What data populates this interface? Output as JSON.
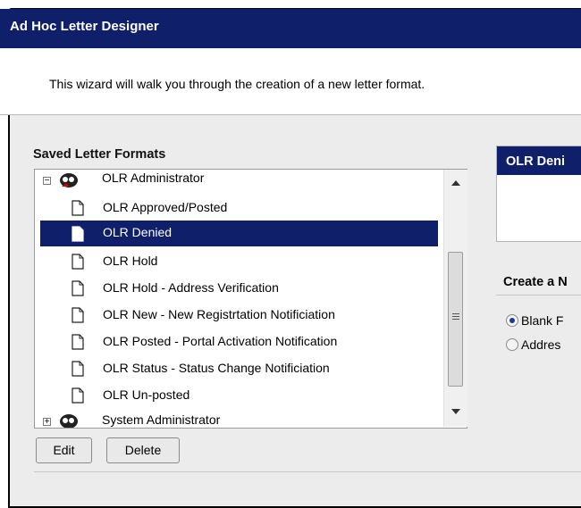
{
  "window": {
    "title": "Ad Hoc Letter Designer"
  },
  "intro": {
    "text": "This wizard will walk you through the creation of a new letter format."
  },
  "saved_formats": {
    "label": "Saved Letter Formats",
    "groups": [
      {
        "label": "OLR Administrator",
        "expanded": true
      },
      {
        "label": "System Administrator",
        "expanded": false
      }
    ],
    "items": [
      {
        "label": "OLR Approved/Posted",
        "selected": false
      },
      {
        "label": "OLR Denied",
        "selected": true
      },
      {
        "label": "OLR Hold",
        "selected": false
      },
      {
        "label": "OLR Hold - Address Verification",
        "selected": false
      },
      {
        "label": "OLR New - New Registrtation Notificiation",
        "selected": false
      },
      {
        "label": "OLR Posted - Portal Activation Notification",
        "selected": false
      },
      {
        "label": "OLR Status - Status Change Notificiation",
        "selected": false
      },
      {
        "label": "OLR Un-posted",
        "selected": false
      }
    ]
  },
  "buttons": {
    "edit": "Edit",
    "delete": "Delete"
  },
  "preview": {
    "title": "OLR Deni"
  },
  "create": {
    "label": "Create a N",
    "options": [
      {
        "label": "Blank F",
        "checked": true
      },
      {
        "label": "Addres",
        "checked": false
      }
    ]
  },
  "colors": {
    "accent": "#0f1f6a",
    "panel_bg": "#ececec"
  }
}
